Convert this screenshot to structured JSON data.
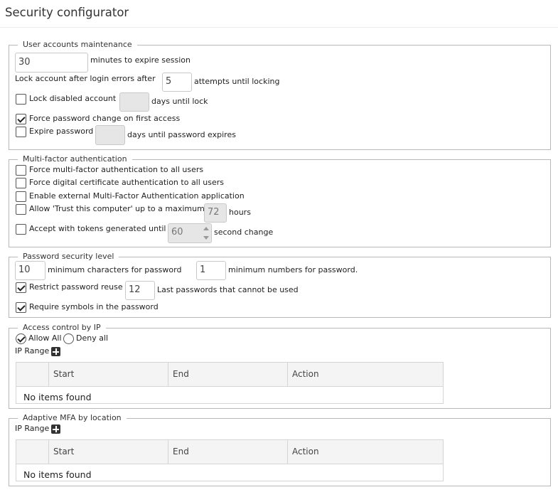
{
  "page": {
    "title": "Security configurator"
  },
  "user_accounts": {
    "legend": "User accounts maintenance",
    "session_minutes": "30",
    "session_label": "minutes to expire session",
    "lock_after_label": "Lock account after login errors after",
    "lock_attempts": "5",
    "lock_attempts_label": "attempts until locking",
    "lock_disabled": {
      "label": "Lock disabled account",
      "checked": false,
      "days": "",
      "days_label": "days until lock"
    },
    "force_change": {
      "label": "Force password change on first access",
      "checked": true
    },
    "expire_password": {
      "label": "Expire password",
      "checked": false,
      "days": "",
      "days_label": "days until password expires"
    }
  },
  "mfa": {
    "legend": "Multi-factor authentication",
    "force_mfa": {
      "label": "Force multi-factor authentication to all users",
      "checked": false
    },
    "force_cert": {
      "label": "Force digital certificate authentication to all users",
      "checked": false
    },
    "external_mfa": {
      "label": "Enable external Multi-Factor Authentication application",
      "checked": false
    },
    "trust_computer": {
      "label": "Allow 'Trust this computer' up to a maximum",
      "checked": false,
      "hours": "72",
      "hours_label": "hours"
    },
    "tokens": {
      "label": "Accept with tokens generated until",
      "checked": false,
      "seconds": "60",
      "seconds_label": "second change"
    }
  },
  "password": {
    "legend": "Password security level",
    "min_chars": "10",
    "min_chars_label": "minimum characters for password",
    "min_numbers": "1",
    "min_numbers_label": "minimum numbers for password.",
    "restrict_reuse": {
      "label": "Restrict password reuse",
      "checked": true,
      "count": "12",
      "count_label": "Last passwords that cannot be used"
    },
    "require_symbols": {
      "label": "Require symbols in the password",
      "checked": true
    }
  },
  "access_ip": {
    "legend": "Access control by IP",
    "allow_all": "Allow All",
    "deny_all": "Deny all",
    "selected": "allow",
    "ip_range_label": "IP Range",
    "columns": [
      "Start",
      "End",
      "Action"
    ],
    "empty_text": "No items found"
  },
  "adaptive_mfa": {
    "legend": "Adaptive MFA by location",
    "ip_range_label": "IP Range",
    "columns": [
      "Start",
      "End",
      "Action"
    ],
    "empty_text": "No items found"
  },
  "icons": {
    "add": "plus-square-icon",
    "check": "checkmark-icon",
    "spinner": "spinner-arrows-icon"
  }
}
